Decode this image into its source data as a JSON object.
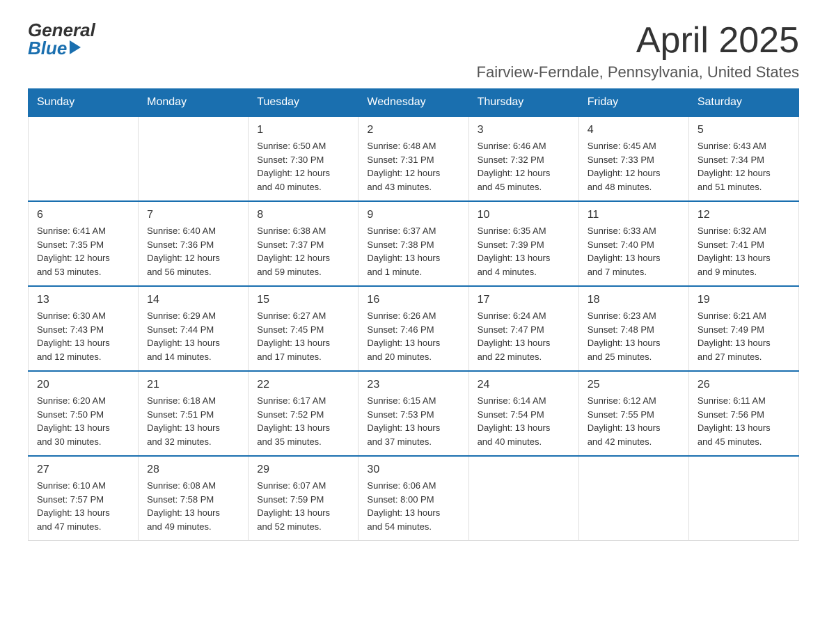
{
  "header": {
    "logo_general": "General",
    "logo_blue": "Blue",
    "title": "April 2025",
    "subtitle": "Fairview-Ferndale, Pennsylvania, United States"
  },
  "calendar": {
    "days_of_week": [
      "Sunday",
      "Monday",
      "Tuesday",
      "Wednesday",
      "Thursday",
      "Friday",
      "Saturday"
    ],
    "weeks": [
      [
        {
          "day": "",
          "info": ""
        },
        {
          "day": "",
          "info": ""
        },
        {
          "day": "1",
          "info": "Sunrise: 6:50 AM\nSunset: 7:30 PM\nDaylight: 12 hours\nand 40 minutes."
        },
        {
          "day": "2",
          "info": "Sunrise: 6:48 AM\nSunset: 7:31 PM\nDaylight: 12 hours\nand 43 minutes."
        },
        {
          "day": "3",
          "info": "Sunrise: 6:46 AM\nSunset: 7:32 PM\nDaylight: 12 hours\nand 45 minutes."
        },
        {
          "day": "4",
          "info": "Sunrise: 6:45 AM\nSunset: 7:33 PM\nDaylight: 12 hours\nand 48 minutes."
        },
        {
          "day": "5",
          "info": "Sunrise: 6:43 AM\nSunset: 7:34 PM\nDaylight: 12 hours\nand 51 minutes."
        }
      ],
      [
        {
          "day": "6",
          "info": "Sunrise: 6:41 AM\nSunset: 7:35 PM\nDaylight: 12 hours\nand 53 minutes."
        },
        {
          "day": "7",
          "info": "Sunrise: 6:40 AM\nSunset: 7:36 PM\nDaylight: 12 hours\nand 56 minutes."
        },
        {
          "day": "8",
          "info": "Sunrise: 6:38 AM\nSunset: 7:37 PM\nDaylight: 12 hours\nand 59 minutes."
        },
        {
          "day": "9",
          "info": "Sunrise: 6:37 AM\nSunset: 7:38 PM\nDaylight: 13 hours\nand 1 minute."
        },
        {
          "day": "10",
          "info": "Sunrise: 6:35 AM\nSunset: 7:39 PM\nDaylight: 13 hours\nand 4 minutes."
        },
        {
          "day": "11",
          "info": "Sunrise: 6:33 AM\nSunset: 7:40 PM\nDaylight: 13 hours\nand 7 minutes."
        },
        {
          "day": "12",
          "info": "Sunrise: 6:32 AM\nSunset: 7:41 PM\nDaylight: 13 hours\nand 9 minutes."
        }
      ],
      [
        {
          "day": "13",
          "info": "Sunrise: 6:30 AM\nSunset: 7:43 PM\nDaylight: 13 hours\nand 12 minutes."
        },
        {
          "day": "14",
          "info": "Sunrise: 6:29 AM\nSunset: 7:44 PM\nDaylight: 13 hours\nand 14 minutes."
        },
        {
          "day": "15",
          "info": "Sunrise: 6:27 AM\nSunset: 7:45 PM\nDaylight: 13 hours\nand 17 minutes."
        },
        {
          "day": "16",
          "info": "Sunrise: 6:26 AM\nSunset: 7:46 PM\nDaylight: 13 hours\nand 20 minutes."
        },
        {
          "day": "17",
          "info": "Sunrise: 6:24 AM\nSunset: 7:47 PM\nDaylight: 13 hours\nand 22 minutes."
        },
        {
          "day": "18",
          "info": "Sunrise: 6:23 AM\nSunset: 7:48 PM\nDaylight: 13 hours\nand 25 minutes."
        },
        {
          "day": "19",
          "info": "Sunrise: 6:21 AM\nSunset: 7:49 PM\nDaylight: 13 hours\nand 27 minutes."
        }
      ],
      [
        {
          "day": "20",
          "info": "Sunrise: 6:20 AM\nSunset: 7:50 PM\nDaylight: 13 hours\nand 30 minutes."
        },
        {
          "day": "21",
          "info": "Sunrise: 6:18 AM\nSunset: 7:51 PM\nDaylight: 13 hours\nand 32 minutes."
        },
        {
          "day": "22",
          "info": "Sunrise: 6:17 AM\nSunset: 7:52 PM\nDaylight: 13 hours\nand 35 minutes."
        },
        {
          "day": "23",
          "info": "Sunrise: 6:15 AM\nSunset: 7:53 PM\nDaylight: 13 hours\nand 37 minutes."
        },
        {
          "day": "24",
          "info": "Sunrise: 6:14 AM\nSunset: 7:54 PM\nDaylight: 13 hours\nand 40 minutes."
        },
        {
          "day": "25",
          "info": "Sunrise: 6:12 AM\nSunset: 7:55 PM\nDaylight: 13 hours\nand 42 minutes."
        },
        {
          "day": "26",
          "info": "Sunrise: 6:11 AM\nSunset: 7:56 PM\nDaylight: 13 hours\nand 45 minutes."
        }
      ],
      [
        {
          "day": "27",
          "info": "Sunrise: 6:10 AM\nSunset: 7:57 PM\nDaylight: 13 hours\nand 47 minutes."
        },
        {
          "day": "28",
          "info": "Sunrise: 6:08 AM\nSunset: 7:58 PM\nDaylight: 13 hours\nand 49 minutes."
        },
        {
          "day": "29",
          "info": "Sunrise: 6:07 AM\nSunset: 7:59 PM\nDaylight: 13 hours\nand 52 minutes."
        },
        {
          "day": "30",
          "info": "Sunrise: 6:06 AM\nSunset: 8:00 PM\nDaylight: 13 hours\nand 54 minutes."
        },
        {
          "day": "",
          "info": ""
        },
        {
          "day": "",
          "info": ""
        },
        {
          "day": "",
          "info": ""
        }
      ]
    ]
  }
}
